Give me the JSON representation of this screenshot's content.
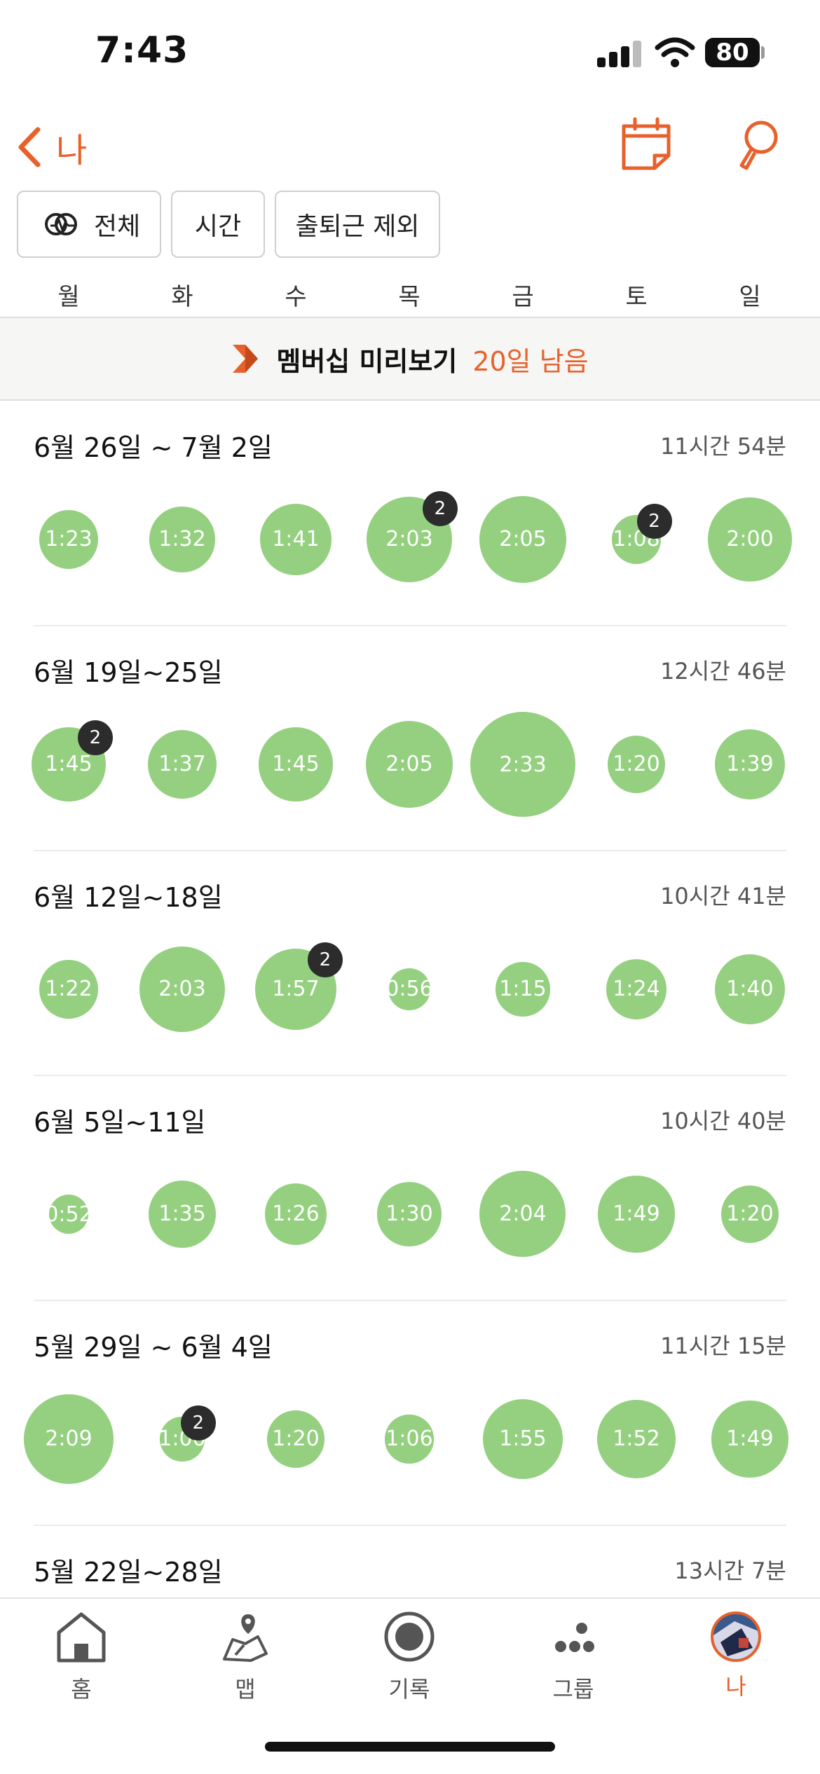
{
  "status_bar": {
    "time": "7:43",
    "battery": "80"
  },
  "header": {
    "back_label": "나"
  },
  "filters": [
    {
      "label": "전체",
      "icon": "activity-rings-icon"
    },
    {
      "label": "시간"
    },
    {
      "label": "출퇴근 제외"
    }
  ],
  "weekdays": [
    "월",
    "화",
    "수",
    "목",
    "금",
    "토",
    "일"
  ],
  "banner": {
    "title": "멤버십 미리보기",
    "days_left": "20일 남음"
  },
  "weeks": [
    {
      "title": "6월 26일 ~ 7월 2일",
      "total": "11시간 54분",
      "days": [
        {
          "time": "1:23",
          "count": null
        },
        {
          "time": "1:32",
          "count": null
        },
        {
          "time": "1:41",
          "count": null
        },
        {
          "time": "2:03",
          "count": "2"
        },
        {
          "time": "2:05",
          "count": null
        },
        {
          "time": "1:08",
          "count": "2"
        },
        {
          "time": "2:00",
          "count": null
        }
      ]
    },
    {
      "title": "6월 19일~25일",
      "total": "12시간 46분",
      "days": [
        {
          "time": "1:45",
          "count": "2"
        },
        {
          "time": "1:37",
          "count": null
        },
        {
          "time": "1:45",
          "count": null
        },
        {
          "time": "2:05",
          "count": null
        },
        {
          "time": "2:33",
          "count": null
        },
        {
          "time": "1:20",
          "count": null
        },
        {
          "time": "1:39",
          "count": null
        }
      ]
    },
    {
      "title": "6월 12일~18일",
      "total": "10시간 41분",
      "days": [
        {
          "time": "1:22",
          "count": null
        },
        {
          "time": "2:03",
          "count": null
        },
        {
          "time": "1:57",
          "count": "2"
        },
        {
          "time": "0:56",
          "count": null
        },
        {
          "time": "1:15",
          "count": null
        },
        {
          "time": "1:24",
          "count": null
        },
        {
          "time": "1:40",
          "count": null
        }
      ]
    },
    {
      "title": "6월 5일~11일",
      "total": "10시간 40분",
      "days": [
        {
          "time": "0:52",
          "count": null
        },
        {
          "time": "1:35",
          "count": null
        },
        {
          "time": "1:26",
          "count": null
        },
        {
          "time": "1:30",
          "count": null
        },
        {
          "time": "2:04",
          "count": null
        },
        {
          "time": "1:49",
          "count": null
        },
        {
          "time": "1:20",
          "count": null
        }
      ]
    },
    {
      "title": "5월 29일 ~ 6월 4일",
      "total": "11시간 15분",
      "days": [
        {
          "time": "2:09",
          "count": null
        },
        {
          "time": "1:00",
          "count": "2"
        },
        {
          "time": "1:20",
          "count": null
        },
        {
          "time": "1:06",
          "count": null
        },
        {
          "time": "1:55",
          "count": null
        },
        {
          "time": "1:52",
          "count": null
        },
        {
          "time": "1:49",
          "count": null
        }
      ]
    },
    {
      "title": "5월 22일~28일",
      "total": "13시간  7분",
      "days": []
    }
  ],
  "tabbar": [
    {
      "label": "홈",
      "icon": "home-icon",
      "active": false
    },
    {
      "label": "맵",
      "icon": "map-pin-icon",
      "active": false
    },
    {
      "label": "기록",
      "icon": "record-icon",
      "active": false
    },
    {
      "label": "그룹",
      "icon": "group-icon",
      "active": false
    },
    {
      "label": "나",
      "icon": "avatar",
      "active": true
    }
  ],
  "colors": {
    "accent": "#e8612c",
    "bubble": "#94d07f",
    "badge": "#2c2c2c"
  }
}
